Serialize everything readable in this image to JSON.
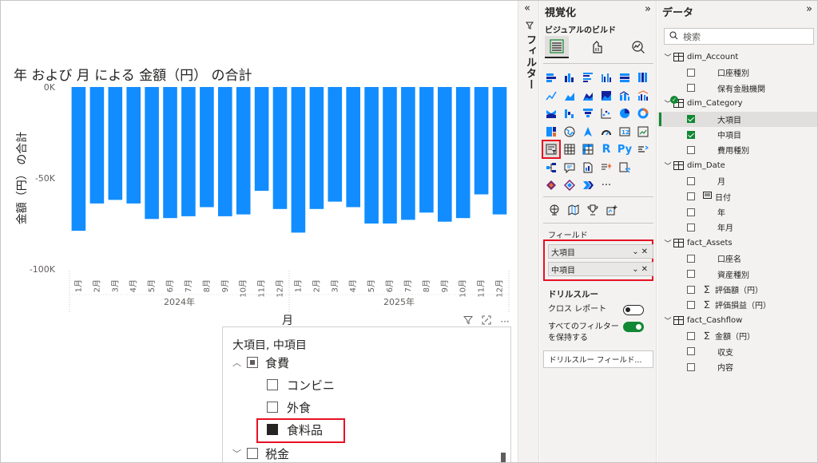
{
  "chart": {
    "title": "年 および 月 による 金額（円） の合計",
    "ylabel": "金額（円） の合計",
    "xlabel": "月"
  },
  "chart_data": {
    "type": "bar",
    "title": "年 および 月 による 金額（円） の合計",
    "xlabel": "月",
    "ylabel": "金額（円） の合計",
    "ylim": [
      -100000,
      0
    ],
    "y_ticks": [
      "0K",
      "-50K",
      "-100K"
    ],
    "y_tick_values": [
      0,
      -50000,
      -100000
    ],
    "year_groups": [
      "2024年",
      "2025年"
    ],
    "categories": [
      "1月",
      "2月",
      "3月",
      "4月",
      "5月",
      "6月",
      "7月",
      "8月",
      "9月",
      "10月",
      "11月",
      "12月",
      "1月",
      "2月",
      "3月",
      "4月",
      "5月",
      "6月",
      "7月",
      "8月",
      "9月",
      "10月",
      "11月",
      "12月"
    ],
    "values": [
      -79000,
      -64000,
      -62000,
      -64000,
      -72500,
      -72000,
      -71000,
      -66000,
      -71000,
      -70000,
      -57000,
      -67000,
      -80000,
      -67000,
      -63000,
      -66000,
      -75000,
      -75000,
      -73000,
      -69000,
      -74000,
      -72000,
      -59000,
      -70000
    ],
    "color": "#118dff",
    "grid": false
  },
  "visual_tools": {
    "filter_icon": "filter-icon",
    "focus_icon": "focus-mode-icon",
    "more": "···"
  },
  "slicer": {
    "header": "大項目, 中項目",
    "items": [
      {
        "label": "食費",
        "level": 0,
        "state": "partial",
        "expanded": true
      },
      {
        "label": "コンビニ",
        "level": 1,
        "state": "none"
      },
      {
        "label": "外食",
        "level": 1,
        "state": "none"
      },
      {
        "label": "食料品",
        "level": 1,
        "state": "full"
      },
      {
        "label": "税金",
        "level": 0,
        "state": "none",
        "expanded": false
      }
    ]
  },
  "filter_strip": {
    "label": "フィルター",
    "collapse": "«"
  },
  "viz_pane": {
    "title": "視覚化",
    "collapse": "»",
    "build_label": "ビジュアルのビルド",
    "more_icon": "···",
    "fields_label": "フィールド",
    "wells": [
      "大項目",
      "中項目"
    ],
    "drill_title": "ドリルスルー",
    "cross_report": "クロス レポート",
    "cross_report_state": "オフ",
    "keep_filters_line1": "すべてのフィルター",
    "keep_filters_line2": "を保持する",
    "keep_filters_state": "オン",
    "drill_fields": "ドリルスルー フィールド..."
  },
  "data_pane": {
    "title": "データ",
    "collapse": "»",
    "search_placeholder": "検索",
    "tree": [
      {
        "type": "table",
        "label": "dim_Account"
      },
      {
        "type": "field",
        "label": "口座種別",
        "checked": false
      },
      {
        "type": "field",
        "label": "保有金融機関",
        "checked": false
      },
      {
        "type": "table",
        "label": "dim_Category",
        "check": true
      },
      {
        "type": "field",
        "label": "大項目",
        "checked": true,
        "selected": true
      },
      {
        "type": "field",
        "label": "中項目",
        "checked": true
      },
      {
        "type": "field",
        "label": "費用種別",
        "checked": false
      },
      {
        "type": "table",
        "label": "dim_Date"
      },
      {
        "type": "field",
        "label": "月",
        "checked": false
      },
      {
        "type": "field",
        "label": "日付",
        "checked": false,
        "icon": "calendar-icon"
      },
      {
        "type": "field",
        "label": "年",
        "checked": false
      },
      {
        "type": "field",
        "label": "年月",
        "checked": false
      },
      {
        "type": "table",
        "label": "fact_Assets"
      },
      {
        "type": "field",
        "label": "口座名",
        "checked": false
      },
      {
        "type": "field",
        "label": "資産種別",
        "checked": false
      },
      {
        "type": "field",
        "label": "評価額（円）",
        "checked": false,
        "icon": "sigma-icon"
      },
      {
        "type": "field",
        "label": "評価損益（円）",
        "checked": false,
        "icon": "sigma-icon"
      },
      {
        "type": "table",
        "label": "fact_Cashflow"
      },
      {
        "type": "field",
        "label": "金額（円）",
        "checked": false,
        "icon": "sigma-icon"
      },
      {
        "type": "field",
        "label": "収支",
        "checked": false
      },
      {
        "type": "field",
        "label": "内容",
        "checked": false
      }
    ]
  }
}
